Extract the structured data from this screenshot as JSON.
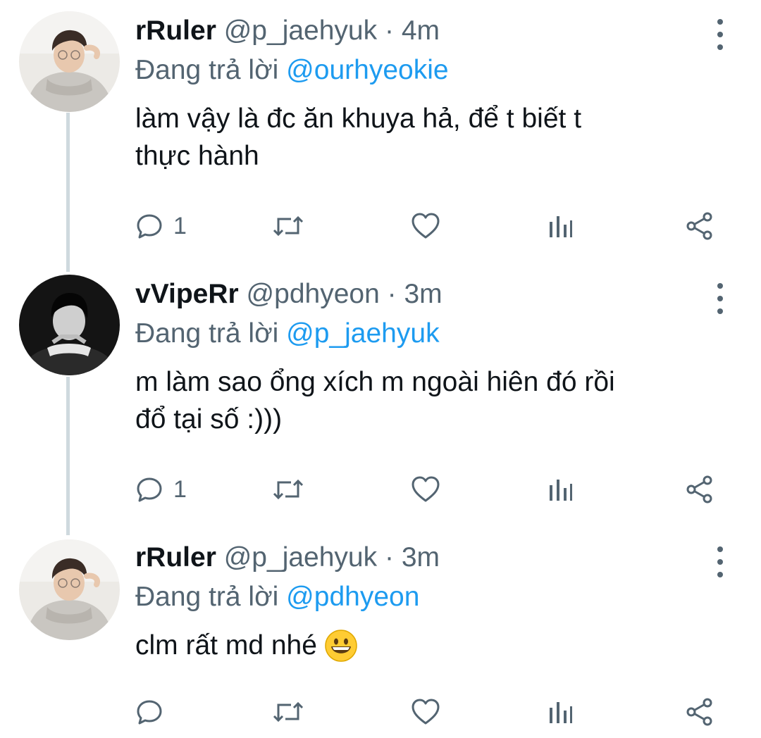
{
  "tweets": [
    {
      "display_name": "rRuler",
      "handle": "@p_jaehyuk",
      "separator": "·",
      "time": "4m",
      "reply_prefix": "Đang trả lời",
      "reply_to": "@ourhyeokie",
      "text": "làm vậy là đc ăn khuya hả, để t biết t\nthực hành",
      "reply_count": "1",
      "avatar_icon": "person-light-photo-icon"
    },
    {
      "display_name": "vVipeRr",
      "handle": "@pdhyeon",
      "separator": "·",
      "time": "3m",
      "reply_prefix": "Đang trả lời",
      "reply_to": "@p_jaehyuk",
      "text": "m làm sao ổng xích m ngoài hiên đó rồi\nđổ tại số :)))",
      "reply_count": "1",
      "avatar_icon": "person-dark-photo-icon"
    },
    {
      "display_name": "rRuler",
      "handle": "@p_jaehyuk",
      "separator": "·",
      "time": "3m",
      "reply_prefix": "Đang trả lời",
      "reply_to": "@pdhyeon",
      "text": "clm rất md nhé",
      "reply_count": "",
      "emoji": "grinning-face-emoji",
      "avatar_icon": "person-light-photo-icon"
    }
  ],
  "icons": {
    "reply": "reply-bubble-icon",
    "retweet": "retweet-icon",
    "like": "heart-icon",
    "analytics": "bar-chart-icon",
    "share": "share-icon",
    "more": "more-vertical-icon"
  },
  "colors": {
    "text": "#0f1419",
    "secondary": "#536471",
    "mention": "#1d9bf0",
    "thread_line": "#cfd9de"
  }
}
